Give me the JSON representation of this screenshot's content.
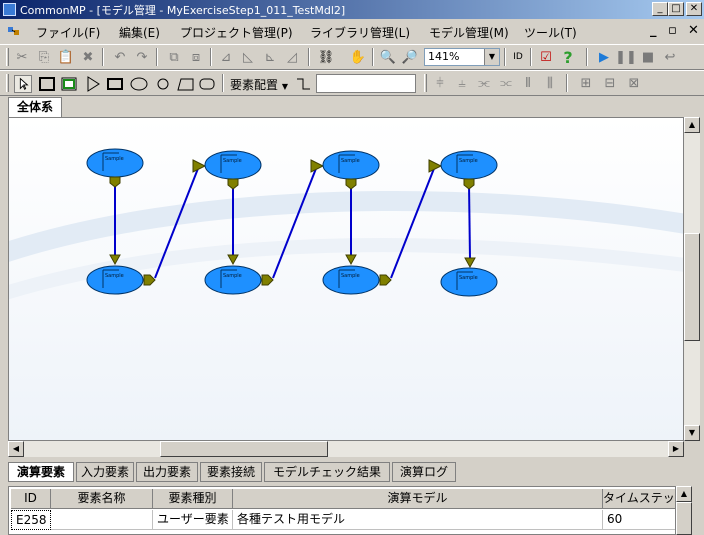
{
  "window": {
    "title": "CommonMP - [モデル管理 - MyExerciseStep1_011_TestMdl2]"
  },
  "menu": {
    "items": [
      "ファイル(F)",
      "編集(E)",
      "プロジェクト管理(P)",
      "ライブラリ管理(L)",
      "モデル管理(M)",
      "ツール(T)"
    ]
  },
  "toolbar": {
    "zoom": "141%",
    "layout_label": "要素配置"
  },
  "document_tab": {
    "label": "全体系"
  },
  "canvas": {
    "element_label": "Sample",
    "node_color": "#1e90ff",
    "link_color": "#0000cc",
    "port_color": "#808000"
  },
  "bottom_tabs": [
    "演算要素",
    "入力要素",
    "出力要素",
    "要素接続",
    "モデルチェック結果",
    "演算ログ"
  ],
  "grid": {
    "columns": [
      "ID",
      "要素名称",
      "要素種別",
      "演算モデル",
      "タイムステップ"
    ],
    "rows": [
      [
        "E258",
        "",
        "ユーザー要素",
        "各種テスト用モデル",
        "60"
      ]
    ]
  }
}
